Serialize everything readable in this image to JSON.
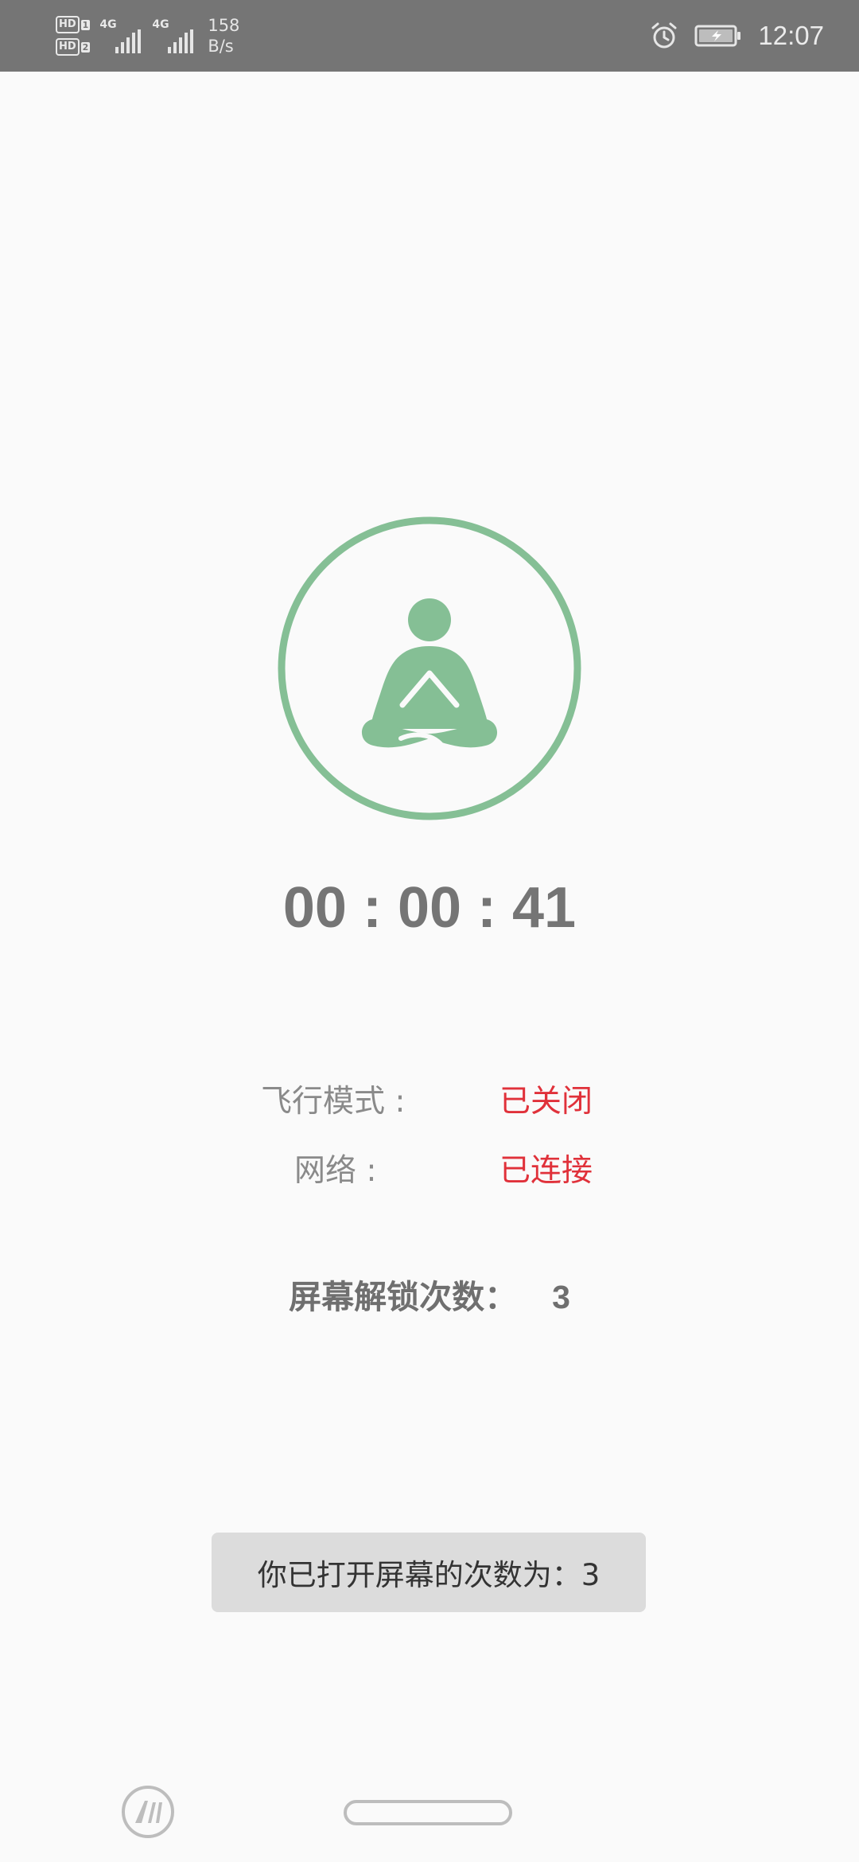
{
  "status_bar": {
    "sim1": "HD",
    "sim1_index": "1",
    "sim2": "HD",
    "sim2_index": "2",
    "network1": "4G",
    "network2": "4G",
    "speed_value": "158",
    "speed_unit": "B/s",
    "time": "12:07",
    "icons": [
      "alarm-icon",
      "battery-charging-icon"
    ]
  },
  "main": {
    "icon": "meditation-icon",
    "accent_color": "#85bf95",
    "timer": "00 : 00 : 41",
    "airplane_label": "飞行模式 :",
    "airplane_value": "已关闭",
    "network_label": "网络 :",
    "network_value": "已连接",
    "status_value_color": "#e0313a",
    "unlock_label": "屏幕解锁次数：",
    "unlock_count": "3"
  },
  "toast": {
    "text": "你已打开屏幕的次数为：3"
  },
  "nav_bar": {
    "icons": [
      "app-logo-icon",
      "home-pill"
    ]
  }
}
